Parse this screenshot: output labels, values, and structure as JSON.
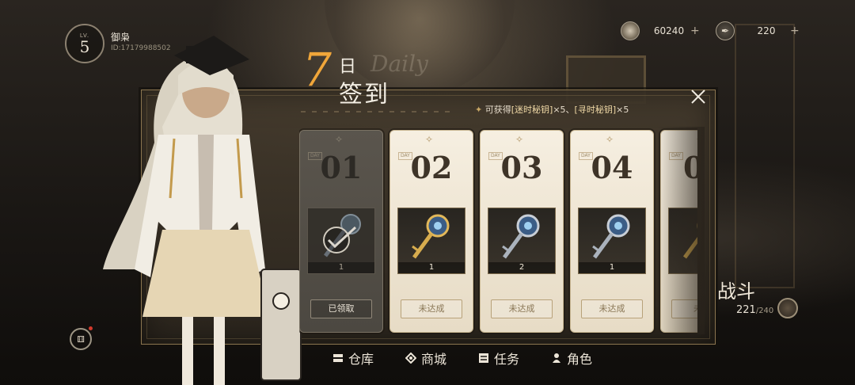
{
  "player": {
    "level_label": "LV.",
    "level": "5",
    "name": "御枭",
    "id": "ID:17179988502"
  },
  "currencies": [
    {
      "icon": "coin-icon",
      "value": "60240",
      "plus": "+"
    },
    {
      "icon": "quill-icon",
      "value": "220",
      "plus": "+"
    }
  ],
  "dialog": {
    "title_number": "7",
    "title_ri": "日",
    "title_daily": "Daily",
    "title_main": "签到",
    "reward_prefix": "可获得",
    "reward_item1": "[迷时秘钥]",
    "reward_mult1": "×5、",
    "reward_item2": "[寻时秘钥]",
    "reward_mult2": "×5",
    "close_label": "✕"
  },
  "days": [
    {
      "tag": "DAY",
      "day": "01",
      "qty": "1",
      "status": "已领取",
      "claimed": true,
      "key": "dark"
    },
    {
      "tag": "DAY",
      "day": "02",
      "qty": "1",
      "status": "未达成",
      "claimed": false,
      "key": "gold"
    },
    {
      "tag": "DAY",
      "day": "03",
      "qty": "2",
      "status": "未达成",
      "claimed": false,
      "key": "silver"
    },
    {
      "tag": "DAY",
      "day": "04",
      "qty": "1",
      "status": "未达成",
      "claimed": false,
      "key": "silver"
    },
    {
      "tag": "DAY",
      "day": "0",
      "qty": "",
      "status": "未达",
      "claimed": false,
      "key": "gold"
    }
  ],
  "battle": {
    "label": "战斗",
    "stamina_current": "221",
    "stamina_max": "/240"
  },
  "nav": [
    {
      "label": "仓库",
      "icon": "warehouse-icon"
    },
    {
      "label": "商城",
      "icon": "shop-icon"
    },
    {
      "label": "任务",
      "icon": "task-icon"
    },
    {
      "label": "角色",
      "icon": "character-icon"
    }
  ],
  "colors": {
    "accent_orange": "#f0a63a",
    "panel_gold": "#8c7650",
    "card_bg": "#f6efe1"
  }
}
